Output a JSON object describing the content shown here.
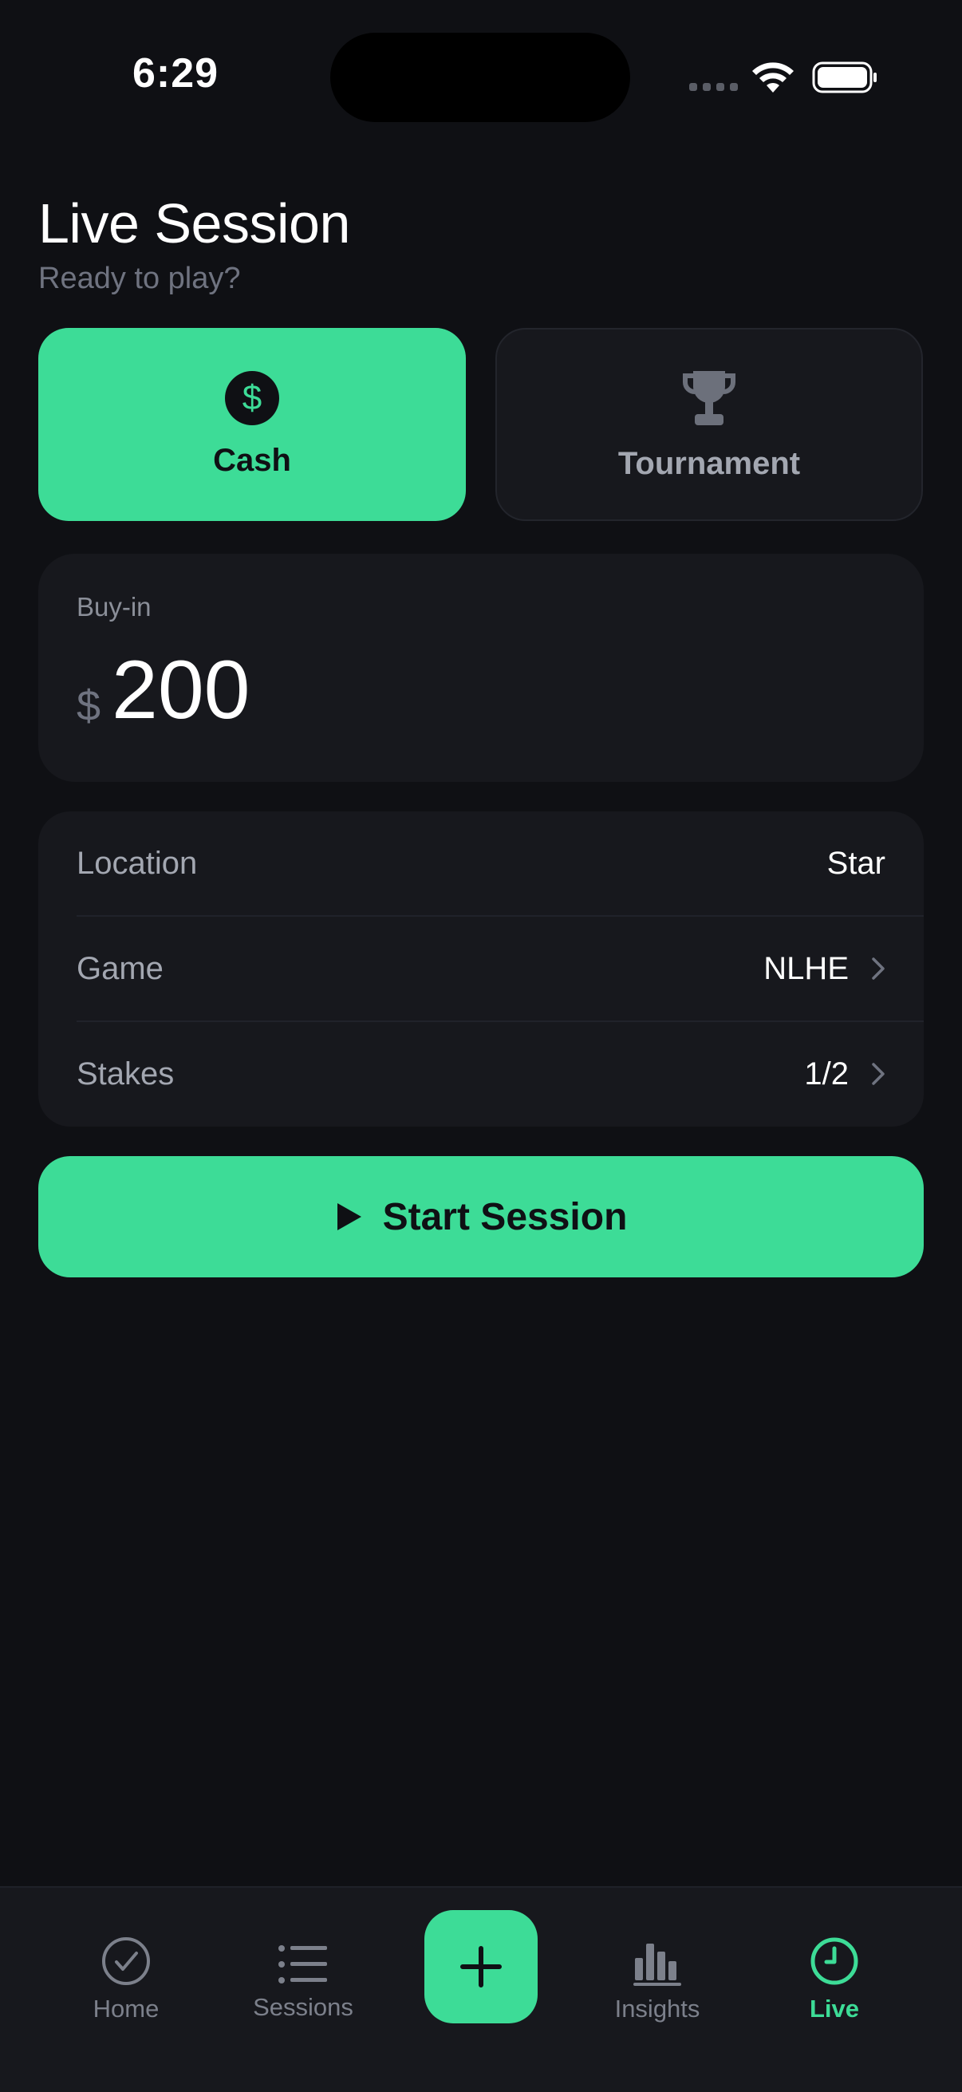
{
  "status_bar": {
    "time": "6:29"
  },
  "header": {
    "title": "Live Session",
    "subtitle": "Ready to play?"
  },
  "session_type": {
    "options": [
      {
        "label": "Cash",
        "icon": "dollar-icon",
        "selected": true
      },
      {
        "label": "Tournament",
        "icon": "trophy-icon",
        "selected": false
      }
    ]
  },
  "buyin": {
    "label": "Buy-in",
    "currency": "$",
    "value": "200"
  },
  "details": {
    "rows": [
      {
        "label": "Location",
        "value": "Star"
      },
      {
        "label": "Game",
        "value": "NLHE"
      },
      {
        "label": "Stakes",
        "value": "1/2"
      }
    ]
  },
  "start_button": {
    "label": "Start Session"
  },
  "tabbar": {
    "tabs": [
      {
        "label": "Home",
        "icon": "checkmark-circle-icon"
      },
      {
        "label": "Sessions",
        "icon": "list-icon"
      },
      {
        "label": "",
        "icon": "plus-icon"
      },
      {
        "label": "Insights",
        "icon": "bar-chart-icon"
      },
      {
        "label": "Live",
        "icon": "clock-icon",
        "active": true
      }
    ]
  },
  "colors": {
    "accent": "#3ddc97",
    "background": "#0f1014",
    "card": "#17181d",
    "muted_text": "#a3a7b1"
  }
}
